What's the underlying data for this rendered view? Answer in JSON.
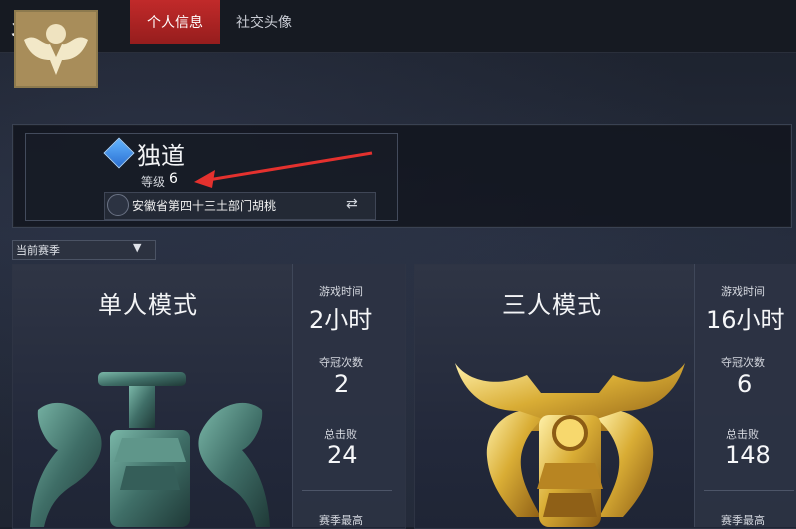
{
  "header": {
    "title": "名片",
    "tabs": [
      {
        "label": "个人信息",
        "active": true
      },
      {
        "label": "社交头像",
        "active": false
      }
    ]
  },
  "profile": {
    "name": "独道",
    "level_label": "等级",
    "level_value": "6",
    "guild": "安徽省第四十三土部门胡桃"
  },
  "season": {
    "label": "当前赛季"
  },
  "modes": [
    {
      "title": "单人模式",
      "stats": [
        {
          "label": "游戏时间",
          "value": "2小时"
        },
        {
          "label": "夺冠次数",
          "value": "2"
        },
        {
          "label": "总击败",
          "value": "24"
        }
      ],
      "footer_label": "赛季最高"
    },
    {
      "title": "三人模式",
      "stats": [
        {
          "label": "游戏时间",
          "value": "16小时"
        },
        {
          "label": "夺冠次数",
          "value": "6"
        },
        {
          "label": "总击败",
          "value": "148"
        }
      ],
      "footer_label": "赛季最高"
    }
  ],
  "colors": {
    "accent_red": "#c12a2a",
    "gold": "#d9b34e",
    "bronze": "#4c8a7d"
  },
  "icons": {
    "avatar": "eagle-emblem",
    "level_badge": "diamond-rank-icon",
    "guild": "guild-icon",
    "switch": "switch-arrows-icon",
    "season_arrow": "chevron-down-icon"
  }
}
